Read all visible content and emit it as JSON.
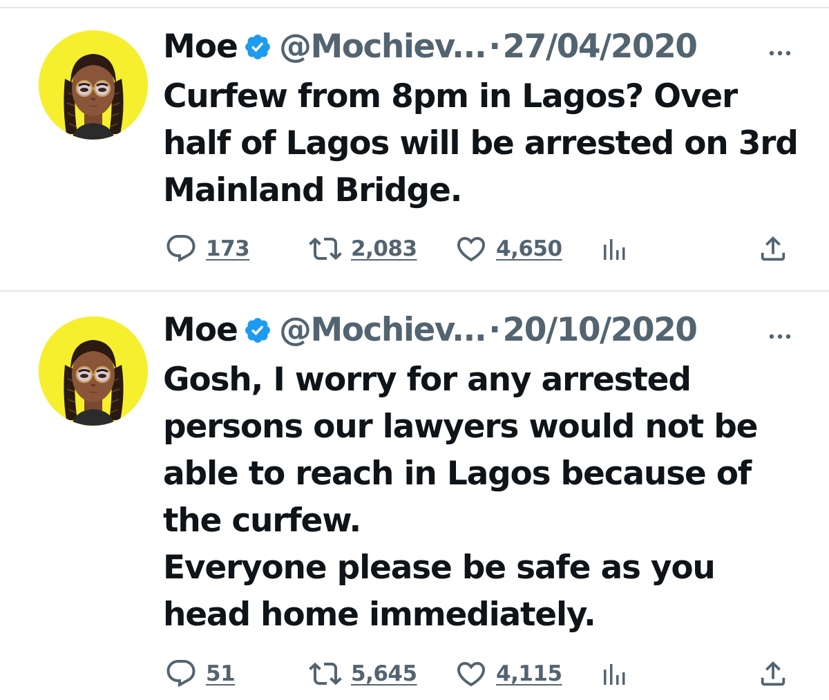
{
  "colors": {
    "text": "#0f1419",
    "muted": "#536471",
    "verified": "#1d9bf0",
    "avatar_bg": "#f6ef2e",
    "divider": "#e3e6e9"
  },
  "tweets": [
    {
      "author": {
        "name": "Moe",
        "handle": "@Mochiev...",
        "verified_icon": "verified-badge-icon"
      },
      "separator": "·",
      "date": "27/04/2020",
      "more_icon": "more-options-icon",
      "text_lines": [
        "Curfew from 8pm in Lagos? Over",
        "half of Lagos will be arrested on 3rd",
        "Mainland Bridge."
      ],
      "stats": {
        "replies": "173",
        "retweets": "2,083",
        "likes": "4,650"
      }
    },
    {
      "author": {
        "name": "Moe",
        "handle": "@Mochiev...",
        "verified_icon": "verified-badge-icon"
      },
      "separator": "·",
      "date": "20/10/2020",
      "more_icon": "more-options-icon",
      "text_lines": [
        "Gosh,  I worry for any arrested",
        "persons our lawyers would not be",
        "able to reach in Lagos because of",
        "the curfew.",
        "Everyone please be safe as you",
        "head home immediately."
      ],
      "stats": {
        "replies": "51",
        "retweets": "5,645",
        "likes": "4,115"
      }
    }
  ]
}
